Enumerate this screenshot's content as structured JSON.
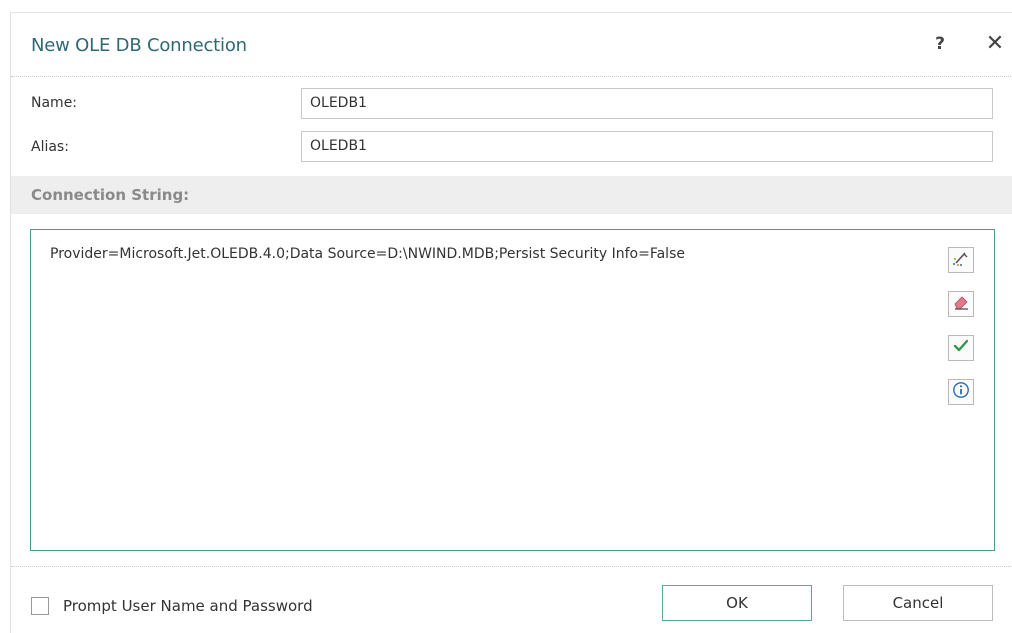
{
  "dialog": {
    "title": "New OLE DB Connection",
    "help_label": "?",
    "close_label": "✕"
  },
  "form": {
    "name_label": "Name:",
    "name_value": "OLEDB1",
    "alias_label": "Alias:",
    "alias_value": "OLEDB1"
  },
  "connection": {
    "section_title": "Connection String:",
    "value": "Provider=Microsoft.Jet.OLEDB.4.0;Data Source=D:\\NWIND.MDB;Persist Security Info=False",
    "side_buttons": [
      {
        "icon": "build-wizard-icon"
      },
      {
        "icon": "eraser-icon"
      },
      {
        "icon": "check-icon"
      },
      {
        "icon": "info-icon"
      }
    ]
  },
  "footer": {
    "prompt_label": "Prompt User Name and Password",
    "prompt_checked": false,
    "ok_label": "OK",
    "cancel_label": "Cancel"
  },
  "colors": {
    "title": "#2f6a73",
    "accent_border": "#4a9a93",
    "check_green": "#2e9a4a",
    "eraser_pink": "#e07a8a",
    "info_blue": "#2a6bb5"
  }
}
